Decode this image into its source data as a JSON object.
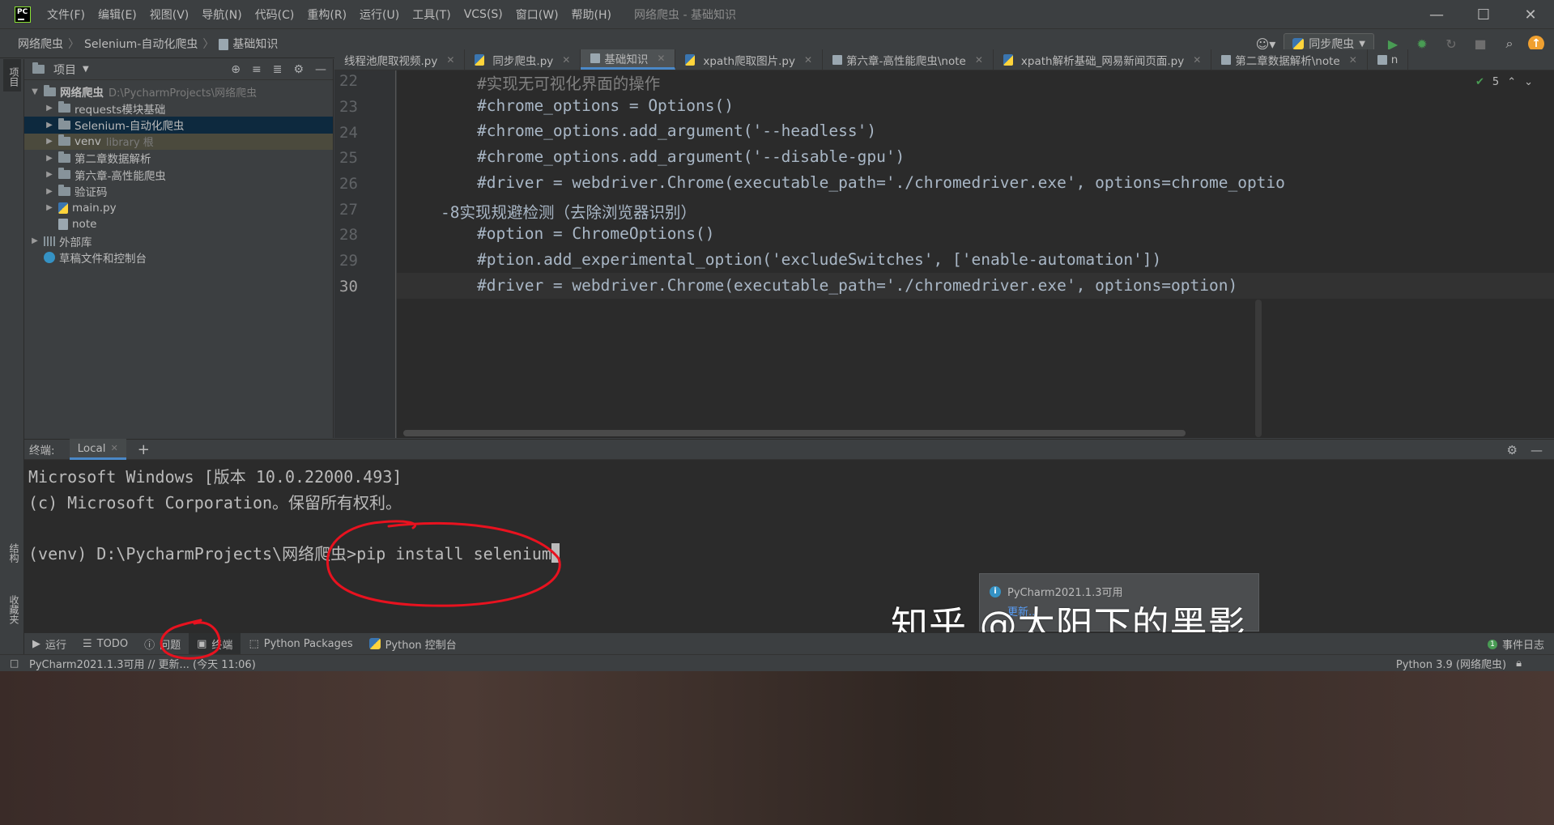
{
  "menubar": {
    "items": [
      "文件(F)",
      "编辑(E)",
      "视图(V)",
      "导航(N)",
      "代码(C)",
      "重构(R)",
      "运行(U)",
      "工具(T)",
      "VCS(S)",
      "窗口(W)",
      "帮助(H)"
    ],
    "window_title": "网络爬虫 - 基础知识"
  },
  "breadcrumb": {
    "items": [
      "网络爬虫",
      "Selenium-自动化爬虫",
      "基础知识"
    ]
  },
  "toolbar": {
    "run_config": "同步爬虫"
  },
  "left_strip": {
    "project_tab": "项目",
    "structure_tab": "结构",
    "favorites_tab": "收藏夹"
  },
  "project": {
    "title": "项目",
    "root_name": "网络爬虫",
    "root_path": "D:\\PycharmProjects\\网络爬虫",
    "items": [
      {
        "name": "requests模块基础"
      },
      {
        "name": "Selenium-自动化爬虫"
      },
      {
        "name": "venv",
        "extra": "library 根"
      },
      {
        "name": "第二章数据解析"
      },
      {
        "name": "第六章-高性能爬虫"
      },
      {
        "name": "验证码"
      },
      {
        "name": "main.py"
      },
      {
        "name": "note"
      }
    ],
    "external_libs": "外部库",
    "scratches": "草稿文件和控制台"
  },
  "editor": {
    "tabs": [
      "线程池爬取视频.py",
      "同步爬虫.py",
      "基础知识",
      "xpath爬取图片.py",
      "第六章-高性能爬虫\\note",
      "xpath解析基础_网易新闻页面.py",
      "第二章数据解析\\note",
      "n"
    ],
    "active_tab": "基础知识",
    "inspection_count": "5",
    "line_numbers": [
      "22",
      "23",
      "24",
      "25",
      "26",
      "27",
      "28",
      "29",
      "30"
    ],
    "lines": [
      "#实现无可视化界面的操作",
      "#chrome_options = Options()",
      "#chrome_options.add_argument('--headless')",
      "#chrome_options.add_argument('--disable-gpu')",
      "#driver = webdriver.Chrome(executable_path='./chromedriver.exe', options=chrome_optio",
      "-8实现规避检测（去除浏览器识别）",
      "#option = ChromeOptions()",
      "#ption.add_experimental_option('excludeSwitches', ['enable-automation'])",
      "#driver = webdriver.Chrome(executable_path='./chromedriver.exe', options=option)"
    ]
  },
  "terminal": {
    "label": "终端:",
    "tab": "Local",
    "lines": [
      "Microsoft Windows [版本 10.0.22000.493]",
      "(c) Microsoft Corporation。保留所有权利。",
      "",
      "(venv) D:\\PycharmProjects\\网络爬虫>pip install selenium"
    ]
  },
  "notification": {
    "title": "PyCharm2021.1.3可用",
    "link": "更新..."
  },
  "watermark": "知乎 @太阳下的黑影",
  "bottom_tabs": [
    "运行",
    "TODO",
    "问题",
    "终端",
    "Python Packages",
    "Python 控制台"
  ],
  "event_log": "事件日志",
  "event_badge": "1",
  "status": {
    "message": "PyCharm2021.1.3可用 // 更新... (今天 11:06)",
    "interpreter": "Python 3.9 (网络爬虫)"
  },
  "colors": {
    "accent": "#4a88c7",
    "annotation": "#e8121f",
    "run": "#499c54"
  }
}
